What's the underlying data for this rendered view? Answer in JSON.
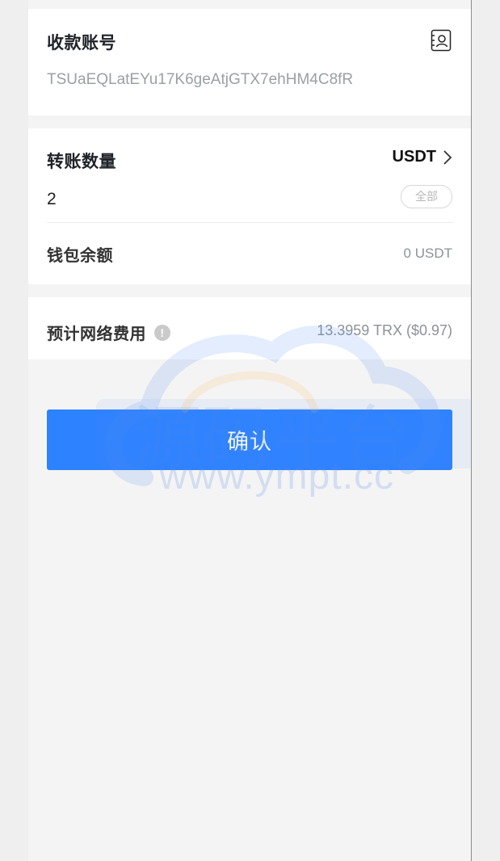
{
  "receive_account": {
    "label": "收款账号",
    "value": "TSUaEQLatEYu17K6geAtjGTX7ehHM4C8fR",
    "icon": "contact-book-icon"
  },
  "transfer": {
    "amount_label": "转账数量",
    "token": "USDT",
    "amount_value": "2",
    "all_button": "全部",
    "balance_label": "钱包余额",
    "balance_value": "0 USDT"
  },
  "fee": {
    "label": "预计网络费用",
    "info_icon": "info-icon",
    "value": "13.3959 TRX ($0.97)"
  },
  "confirm": {
    "label": "确认",
    "color": "#2d82ff"
  },
  "watermark": {
    "text": "www.ympt.cc"
  }
}
